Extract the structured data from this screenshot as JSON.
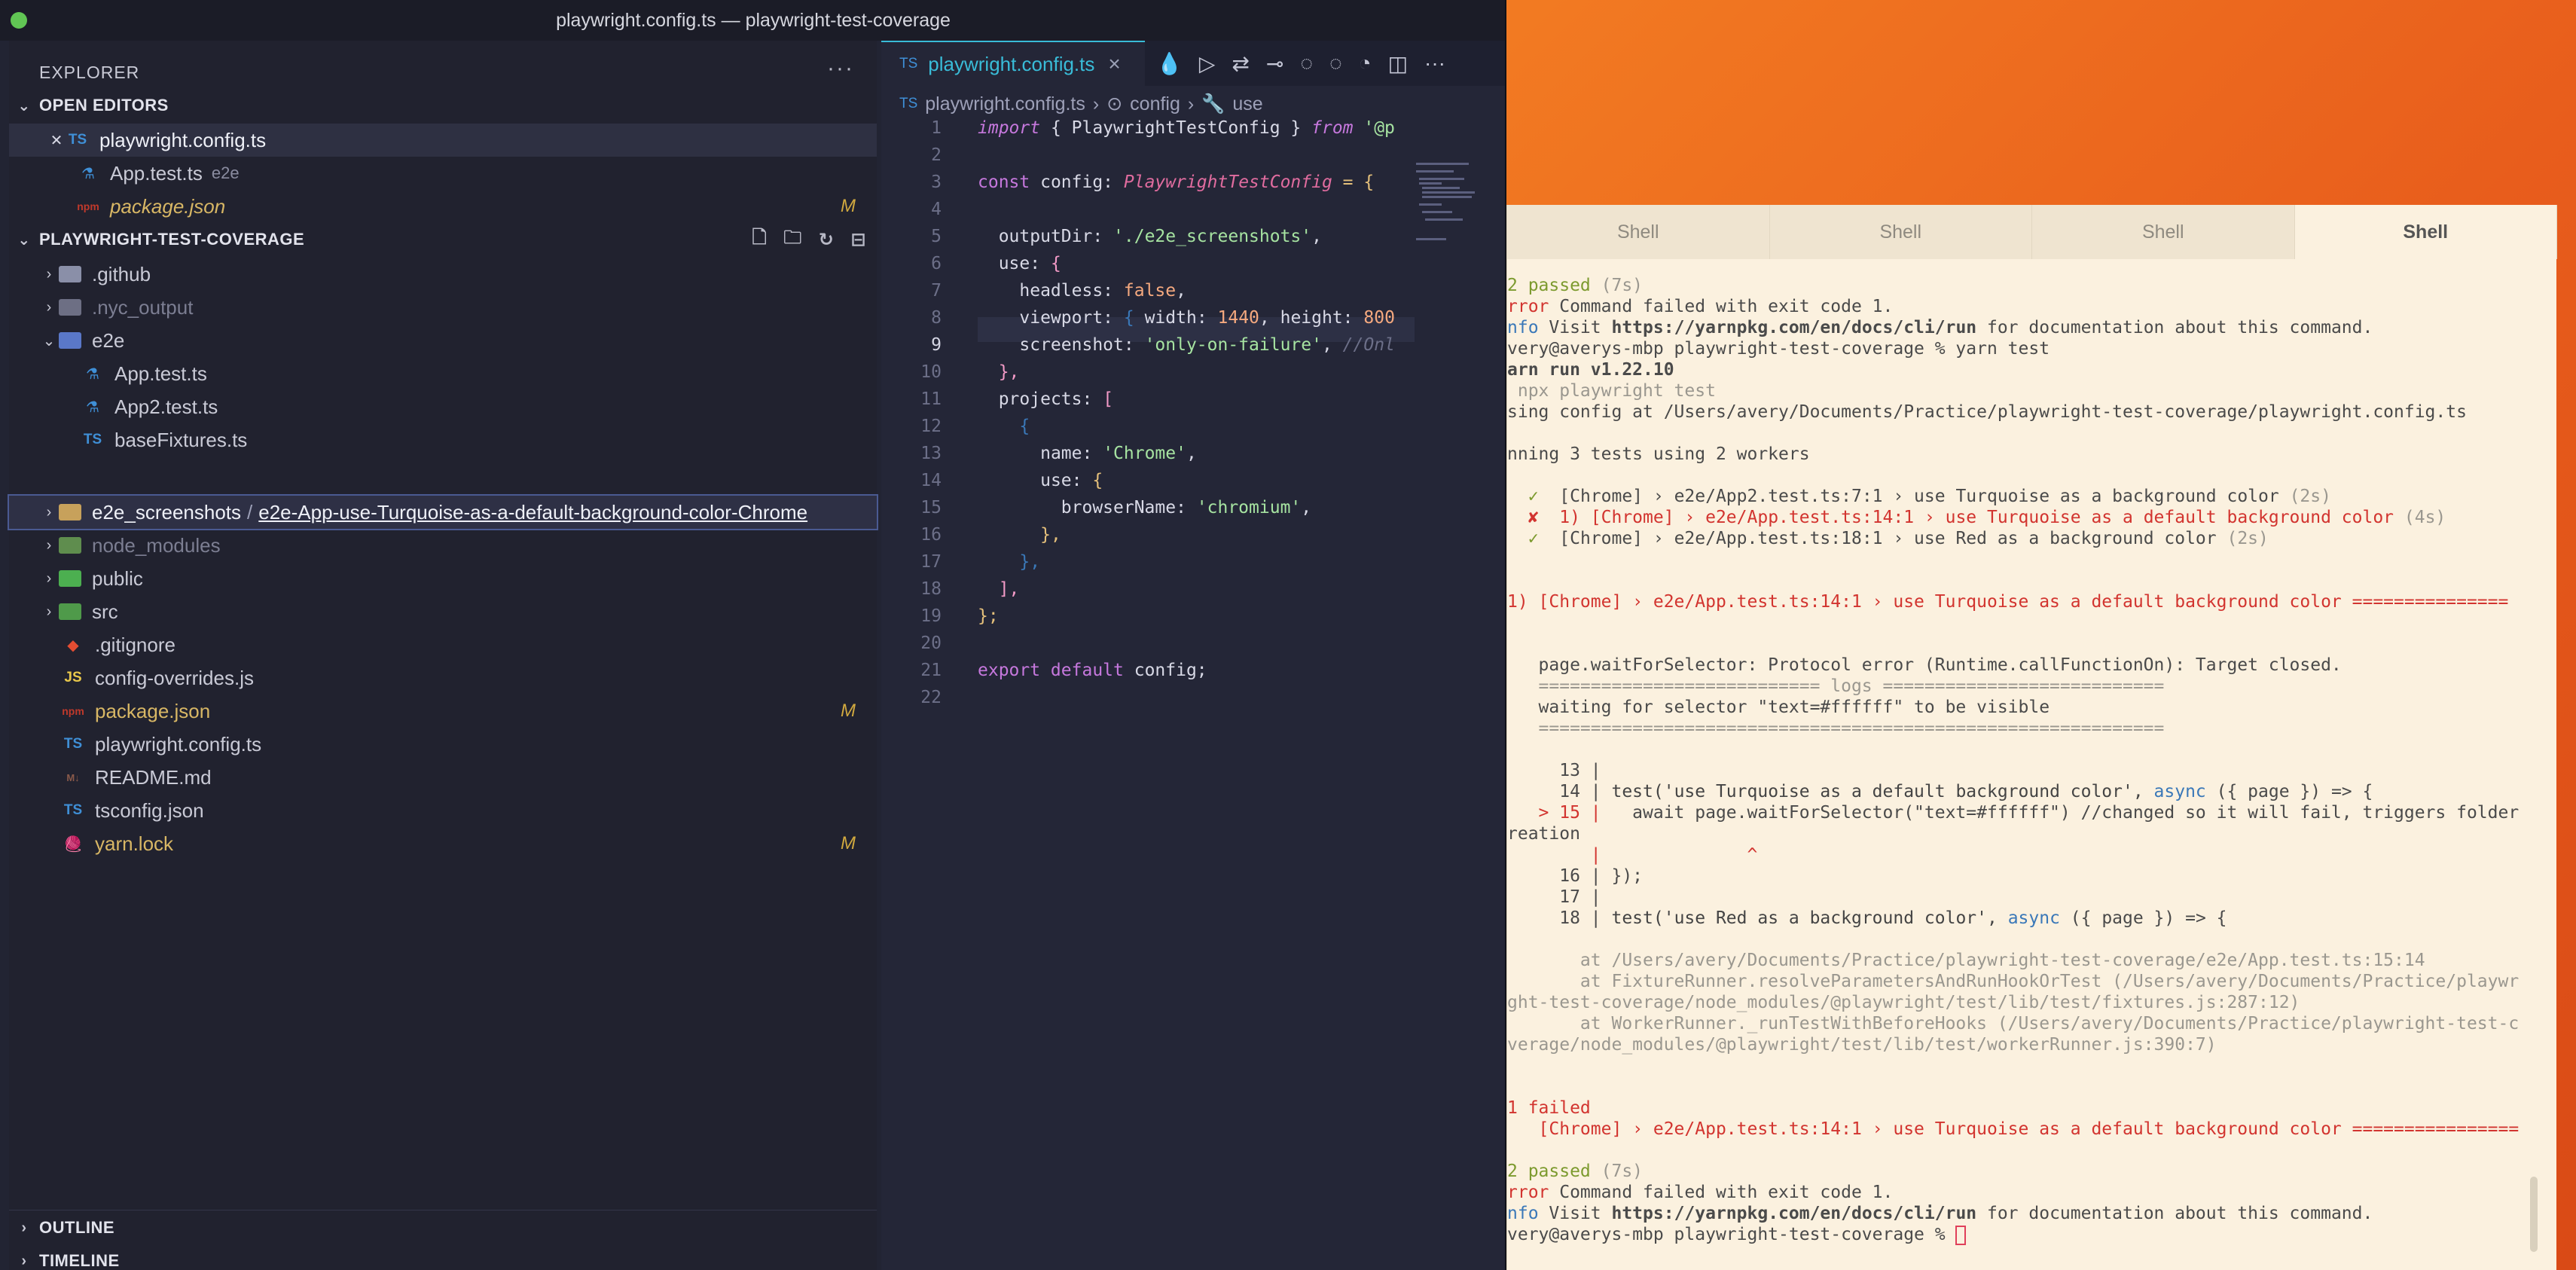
{
  "window": {
    "title": "playwright.config.ts — playwright-test-coverage"
  },
  "sidebar": {
    "title": "EXPLORER",
    "open_editors_title": "OPEN EDITORS",
    "open_editors": [
      {
        "name": "playwright.config.ts",
        "desc": "",
        "badge": ""
      },
      {
        "name": "App.test.ts",
        "desc": "e2e",
        "badge": ""
      },
      {
        "name": "package.json",
        "desc": "",
        "badge": "M"
      }
    ],
    "project_title": "PLAYWRIGHT-TEST-COVERAGE",
    "tree": [
      {
        "name": ".github",
        "badge": ""
      },
      {
        "name": ".nyc_output",
        "badge": ""
      },
      {
        "name": "e2e",
        "badge": ""
      },
      {
        "name": "App.test.ts",
        "badge": ""
      },
      {
        "name": "App2.test.ts",
        "badge": ""
      },
      {
        "name": "baseFixtures.ts",
        "badge": ""
      },
      {
        "name": "e2e_screenshots",
        "badge": ""
      },
      {
        "name": "node_modules",
        "badge": ""
      },
      {
        "name": "public",
        "badge": ""
      },
      {
        "name": "src",
        "badge": ""
      },
      {
        "name": ".gitignore",
        "badge": ""
      },
      {
        "name": "config-overrides.js",
        "badge": ""
      },
      {
        "name": "package.json",
        "badge": "M"
      },
      {
        "name": "playwright.config.ts",
        "badge": ""
      },
      {
        "name": "README.md",
        "badge": ""
      },
      {
        "name": "tsconfig.json",
        "badge": ""
      },
      {
        "name": "yarn.lock",
        "badge": "M"
      }
    ],
    "compact_child": "e2e-App-use-Turquoise-as-a-default-background-color-Chrome",
    "outline_title": "OUTLINE",
    "timeline_title": "TIMELINE"
  },
  "editor": {
    "tab_label": "playwright.config.ts",
    "breadcrumbs": [
      "playwright.config.ts",
      "config",
      "use"
    ],
    "line_numbers": [
      "1",
      "2",
      "3",
      "4",
      "5",
      "6",
      "7",
      "8",
      "9",
      "10",
      "11",
      "12",
      "13",
      "14",
      "15",
      "16",
      "17",
      "18",
      "19",
      "20",
      "21",
      "22"
    ],
    "current_line": "9",
    "code": {
      "l1_kw": "import",
      "l1_rest": " { PlaywrightTestConfig } ",
      "l1_from": "from",
      "l1_str": " '@p",
      "l3_kw": "const",
      "l3_name": " config: ",
      "l3_type": "PlaywrightTestConfig",
      "l3_rest": " = {",
      "l5_key": "outputDir: ",
      "l5_str": "'./e2e_screenshots'",
      "l5_end": ",",
      "l6_key": "use: ",
      "l6_br": "{",
      "l7_key": "headless: ",
      "l7_val": "false",
      "l7_end": ",",
      "l8_key": "viewport: ",
      "l8_br": "{",
      "l8_a": " width: ",
      "l8_w": "1440",
      "l8_b": ", height: ",
      "l8_h": "800",
      "l9_key": "screenshot: ",
      "l9_str": "'only-on-failure'",
      "l9_end": ", ",
      "l9_cm": "//Onl",
      "l10": "},",
      "l11_key": "projects: ",
      "l11_br": "[",
      "l12": "{",
      "l13_key": "name: ",
      "l13_str": "'Chrome'",
      "l13_end": ",",
      "l14_key": "use: ",
      "l14_br": "{",
      "l15_key": "browserName: ",
      "l15_str": "'chromium'",
      "l15_end": ",",
      "l16": "},",
      "l17": "},",
      "l18": "],",
      "l19": "};",
      "l21_kw": "export default",
      "l21_rest": " config;"
    }
  },
  "terminal": {
    "tabs": [
      "Shell",
      "Shell",
      "Shell",
      "Shell"
    ],
    "active_tab": 3,
    "lines": {
      "t1": "2 passed ",
      "t1b": "(7s)",
      "t2a": "rror",
      "t2b": " Command failed with exit code 1.",
      "t3a": "nfo",
      "t3b": " Visit ",
      "t3c": "https://yarnpkg.com/en/docs/cli/run",
      "t3d": " for documentation about this command.",
      "t4": "very@averys-mbp playwright-test-coverage % yarn test",
      "t5": "arn run v1.22.10",
      "t6": " npx playwright test",
      "t7": "sing config at /Users/avery/Documents/Practice/playwright-test-coverage/playwright.config.ts",
      "t8": "nning 3 tests using 2 workers",
      "t9a": "  ✓  ",
      "t9b": "[Chrome] › e2e/App2.test.ts:7:1 › use Turquoise as a background color ",
      "t9c": "(2s)",
      "t10a": "  ✘  ",
      "t10b": "1) [Chrome] › e2e/App.test.ts:14:1 › use Turquoise as a default background color ",
      "t10c": "(4s)",
      "t11a": "  ✓  ",
      "t11b": "[Chrome] › e2e/App.test.ts:18:1 › use Red as a background color ",
      "t11c": "(2s)",
      "t12": "1) [Chrome] › e2e/App.test.ts:14:1 › use Turquoise as a default background color ===============",
      "t13": "   page.waitForSelector: Protocol error (Runtime.callFunctionOn): Target closed.",
      "t14": "   =========================== logs ===========================",
      "t15": "   waiting for selector \"text=#ffffff\" to be visible",
      "t16": "   ============================================================",
      "t17": "     13 |",
      "t18a": "     14 | ",
      "t18b": "test('use Turquoise as a default background color', ",
      "t18c": "async",
      "t18d": " ({ page }) => {",
      "t19a": "   > 15 |",
      "t19b": "   await page.waitForSelector(\"text=#ffffff\") //changed so it will fail, triggers folder",
      "t20": "reation",
      "t21": "        |              ^",
      "t22": "     16 | });",
      "t23": "     17 |",
      "t24a": "     18 | ",
      "t24b": "test('use Red as a background color', ",
      "t24c": "async",
      "t24d": " ({ page }) => {",
      "t25": "       at /Users/avery/Documents/Practice/playwright-test-coverage/e2e/App.test.ts:15:14",
      "t26": "       at FixtureRunner.resolveParametersAndRunHookOrTest (/Users/avery/Documents/Practice/playwr",
      "t27": "ght-test-coverage/node_modules/@playwright/test/lib/test/fixtures.js:287:12)",
      "t28": "       at WorkerRunner._runTestWithBeforeHooks (/Users/avery/Documents/Practice/playwright-test-c",
      "t29": "verage/node_modules/@playwright/test/lib/test/workerRunner.js:390:7)",
      "t30": "1 failed",
      "t31": "   [Chrome] › e2e/App.test.ts:14:1 › use Turquoise as a default background color ================",
      "t32": "2 passed ",
      "t32b": "(7s)",
      "t33a": "rror",
      "t33b": " Command failed with exit code 1.",
      "t34a": "nfo",
      "t34b": " Visit ",
      "t34c": "https://yarnpkg.com/en/docs/cli/run",
      "t34d": " for documentation about this command.",
      "t35": "very@averys-mbp playwright-test-coverage % "
    }
  },
  "colors": {
    "accent": "#39bcd8",
    "terminal_bg": "#fbf1df",
    "error": "#d2342f",
    "success": "#7c9a2e"
  }
}
